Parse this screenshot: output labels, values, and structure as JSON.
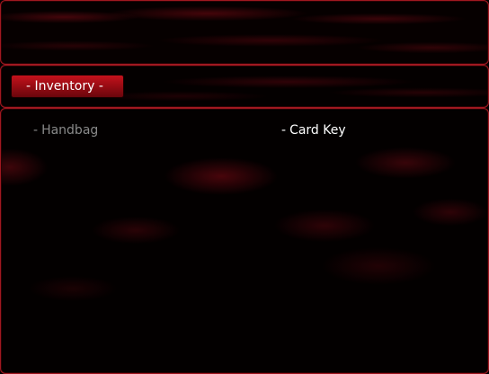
{
  "help_window": {
    "text": ""
  },
  "categories": {
    "selected_label": "- Inventory -"
  },
  "items": [
    {
      "dash": "-",
      "label": "Handbag",
      "enabled": false
    },
    {
      "dash": "-",
      "label": "Card Key",
      "enabled": true
    }
  ],
  "colors": {
    "border": "#a01820",
    "tab_highlight": "#b0101a",
    "text_enabled": "#ffffff",
    "text_disabled": "#8a8a8a"
  }
}
